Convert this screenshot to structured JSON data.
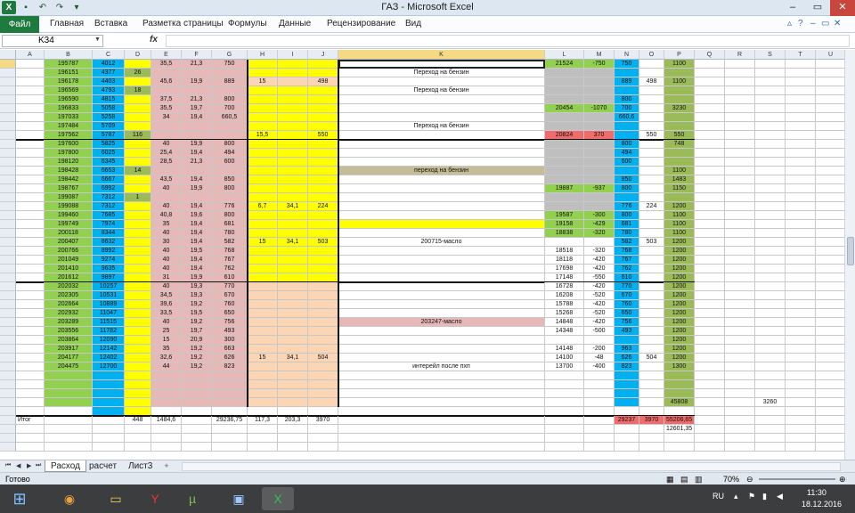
{
  "window": {
    "title": "ГАЗ  -  Microsoft Excel"
  },
  "ribbon": {
    "file_tab": "Файл",
    "tabs": [
      "Главная",
      "Вставка",
      "Разметка страницы",
      "Формулы",
      "Данные",
      "Рецензирование",
      "Вид"
    ]
  },
  "formula_bar": {
    "name_box": "K34",
    "fx_label": "fx",
    "formula": ""
  },
  "columns": [
    "A",
    "B",
    "C",
    "D",
    "E",
    "F",
    "G",
    "H",
    "I",
    "J",
    "K",
    "L",
    "M",
    "N",
    "O",
    "P",
    "Q",
    "R",
    "S",
    "T",
    "U"
  ],
  "rows": [
    {
      "r": "34",
      "B": "195787",
      "C": "4012",
      "E": "35,5",
      "F": "21,3",
      "G": "750",
      "L": "21524",
      "M": "-750",
      "N": "750",
      "P": "1100"
    },
    {
      "r": "35",
      "B": "196151",
      "C": "4377",
      "D": "26",
      "K": "Переход на бензин"
    },
    {
      "r": "36",
      "B": "196178",
      "C": "4403",
      "E": "45,6",
      "F": "19,9",
      "G": "889",
      "H": "15",
      "J": "498",
      "N": "889",
      "O": "498",
      "P": "1100"
    },
    {
      "r": "37",
      "B": "196569",
      "C": "4793",
      "D": "18",
      "K": "Переход на бензин"
    },
    {
      "r": "38",
      "B": "196590",
      "C": "4815",
      "E": "37,5",
      "F": "21,3",
      "G": "800",
      "N": "800"
    },
    {
      "r": "39",
      "B": "196833",
      "C": "5058",
      "E": "35,5",
      "F": "19,7",
      "G": "700",
      "L": "20454",
      "M": "-1070",
      "N": "700",
      "P": "3230"
    },
    {
      "r": "40",
      "B": "197033",
      "C": "5258",
      "E": "34",
      "F": "19,4",
      "G": "660,5",
      "N": "660,6"
    },
    {
      "r": "41",
      "B": "197484",
      "C": "5709",
      "K": "Переход на бензин"
    },
    {
      "r": "42",
      "B": "197562",
      "C": "5787",
      "D": "116",
      "H": "15,5",
      "J": "550",
      "L": "20824",
      "M": "370",
      "O": "550",
      "P": "550"
    },
    {
      "r": "43",
      "B": "197600",
      "C": "5825",
      "E": "40",
      "F": "19,9",
      "G": "800",
      "N": "800",
      "P": "748"
    },
    {
      "r": "44",
      "B": "197800",
      "C": "6025",
      "E": "25,4",
      "F": "19,4",
      "G": "494",
      "N": "494"
    },
    {
      "r": "45",
      "B": "198120",
      "C": "6345",
      "E": "28,5",
      "F": "21,3",
      "G": "600",
      "N": "600"
    },
    {
      "r": "46",
      "B": "198428",
      "C": "6653",
      "D": "14",
      "K": "переход на бензин",
      "P": "1100"
    },
    {
      "r": "47",
      "B": "198442",
      "C": "6667",
      "E": "43,5",
      "F": "19,4",
      "G": "850",
      "N": "850",
      "P": "1483"
    },
    {
      "r": "48",
      "B": "198767",
      "C": "6992",
      "E": "40",
      "F": "19,9",
      "G": "800",
      "L": "19887",
      "M": "-937",
      "N": "800",
      "P": "1150"
    },
    {
      "r": "49",
      "B": "199087",
      "C": "7312",
      "D": "1"
    },
    {
      "r": "50",
      "B": "199088",
      "C": "7312",
      "E": "40",
      "F": "19,4",
      "G": "776",
      "H": "6,7",
      "I": "34,1",
      "J": "224",
      "N": "776",
      "O": "224",
      "P": "1200"
    },
    {
      "r": "51",
      "B": "199460",
      "C": "7685",
      "E": "40,8",
      "F": "19,6",
      "G": "800",
      "L": "19587",
      "M": "-300",
      "N": "800",
      "P": "1100"
    },
    {
      "r": "52",
      "B": "199749",
      "C": "7974",
      "E": "35",
      "F": "19,4",
      "G": "681",
      "L": "19158",
      "M": "-429",
      "N": "681",
      "P": "1100"
    },
    {
      "r": "53",
      "B": "200118",
      "C": "8344",
      "E": "40",
      "F": "19,4",
      "G": "780",
      "L": "18838",
      "M": "-320",
      "N": "780",
      "P": "1100"
    },
    {
      "r": "54",
      "B": "200407",
      "C": "8632",
      "E": "30",
      "F": "19,4",
      "G": "582",
      "H": "15",
      "I": "34,1",
      "J": "503",
      "K": "200715-масло",
      "N": "582",
      "O": "503",
      "P": "1200"
    },
    {
      "r": "55",
      "B": "200766",
      "C": "8992",
      "E": "40",
      "F": "19,5",
      "G": "768",
      "L": "18518",
      "M": "-320",
      "N": "768",
      "P": "1200"
    },
    {
      "r": "56",
      "B": "201049",
      "C": "9274",
      "E": "40",
      "F": "19,4",
      "G": "767",
      "L": "18118",
      "M": "-420",
      "N": "767",
      "P": "1200"
    },
    {
      "r": "57",
      "B": "201410",
      "C": "9635",
      "E": "40",
      "F": "19,4",
      "G": "762",
      "L": "17698",
      "M": "-420",
      "N": "762",
      "P": "1200"
    },
    {
      "r": "58",
      "B": "201612",
      "C": "9897",
      "E": "31",
      "F": "19,9",
      "G": "610",
      "L": "17148",
      "M": "-550",
      "N": "610",
      "P": "1200"
    },
    {
      "r": "59",
      "B": "202032",
      "C": "10257",
      "E": "40",
      "F": "19,3",
      "G": "770",
      "L": "16728",
      "M": "-420",
      "N": "770",
      "P": "1200"
    },
    {
      "r": "60",
      "B": "202305",
      "C": "10531",
      "E": "34,5",
      "F": "19,3",
      "G": "670",
      "L": "16208",
      "M": "-520",
      "N": "670",
      "P": "1200"
    },
    {
      "r": "61",
      "B": "202664",
      "C": "10889",
      "E": "39,6",
      "F": "19,2",
      "G": "760",
      "L": "15788",
      "M": "-420",
      "N": "760",
      "P": "1200"
    },
    {
      "r": "62",
      "B": "202932",
      "C": "11047",
      "E": "33,5",
      "F": "19,5",
      "G": "650",
      "L": "15268",
      "M": "-520",
      "N": "650",
      "P": "1200"
    },
    {
      "r": "63",
      "B": "203289",
      "C": "11515",
      "E": "40",
      "F": "19,2",
      "G": "756",
      "K": "203247-масло",
      "L": "14848",
      "M": "-420",
      "N": "756",
      "P": "1200"
    },
    {
      "r": "64",
      "B": "203556",
      "C": "11782",
      "E": "25",
      "F": "19,7",
      "G": "493",
      "L": "14348",
      "M": "-500",
      "N": "493",
      "P": "1200"
    },
    {
      "r": "65",
      "B": "203864",
      "C": "12090",
      "E": "15",
      "F": "20,9",
      "G": "300",
      "P": "1200"
    },
    {
      "r": "66",
      "B": "203917",
      "C": "12142",
      "E": "35",
      "F": "19,2",
      "G": "663",
      "L": "14148",
      "M": "-200",
      "N": "963",
      "P": "1200"
    },
    {
      "r": "67",
      "B": "204177",
      "C": "12402",
      "E": "32,6",
      "F": "19,2",
      "G": "626",
      "H": "15",
      "I": "34,1",
      "J": "504",
      "L": "14100",
      "M": "-48",
      "N": "626",
      "O": "504",
      "P": "1200"
    },
    {
      "r": "68",
      "B": "204475",
      "C": "12700",
      "E": "44",
      "F": "19,2",
      "G": "823",
      "K": "интерейл после пхп",
      "L": "13700",
      "M": "-400",
      "N": "823",
      "P": "1300"
    },
    {
      "r": "69"
    },
    {
      "r": "70"
    },
    {
      "r": "71"
    },
    {
      "r": "72",
      "P": "45808",
      "S": "3260"
    },
    {
      "r": "73"
    },
    {
      "r": "74",
      "A": "Итог",
      "D": "448",
      "E": "1484,6",
      "G": "29236,75",
      "H": "117,3",
      "I": "203,3",
      "J": "3970",
      "N": "29237",
      "O": "3970",
      "P": "55206,65"
    },
    {
      "r": "75",
      "P": "12601,35"
    },
    {
      "r": "76"
    },
    {
      "r": "77"
    }
  ],
  "sheets": {
    "tabs": [
      "Расход",
      "расчет",
      "Лист3"
    ],
    "active": "Расход"
  },
  "status": {
    "ready": "Готово",
    "zoom": "70%"
  },
  "taskbar": {
    "lang": "RU",
    "time": "11:30",
    "date": "18.12.2016"
  },
  "colors": {
    "green": "#92d050",
    "blue": "#00b0f0",
    "yellow": "#ffff00",
    "pink": "#e6b8b7",
    "peach": "#fcd5b4",
    "gray": "#bfbfbf",
    "olive": "#9bbb59",
    "lgreen": "#92d050",
    "red": "#f06b6b",
    "tan": "#c4bd97"
  }
}
